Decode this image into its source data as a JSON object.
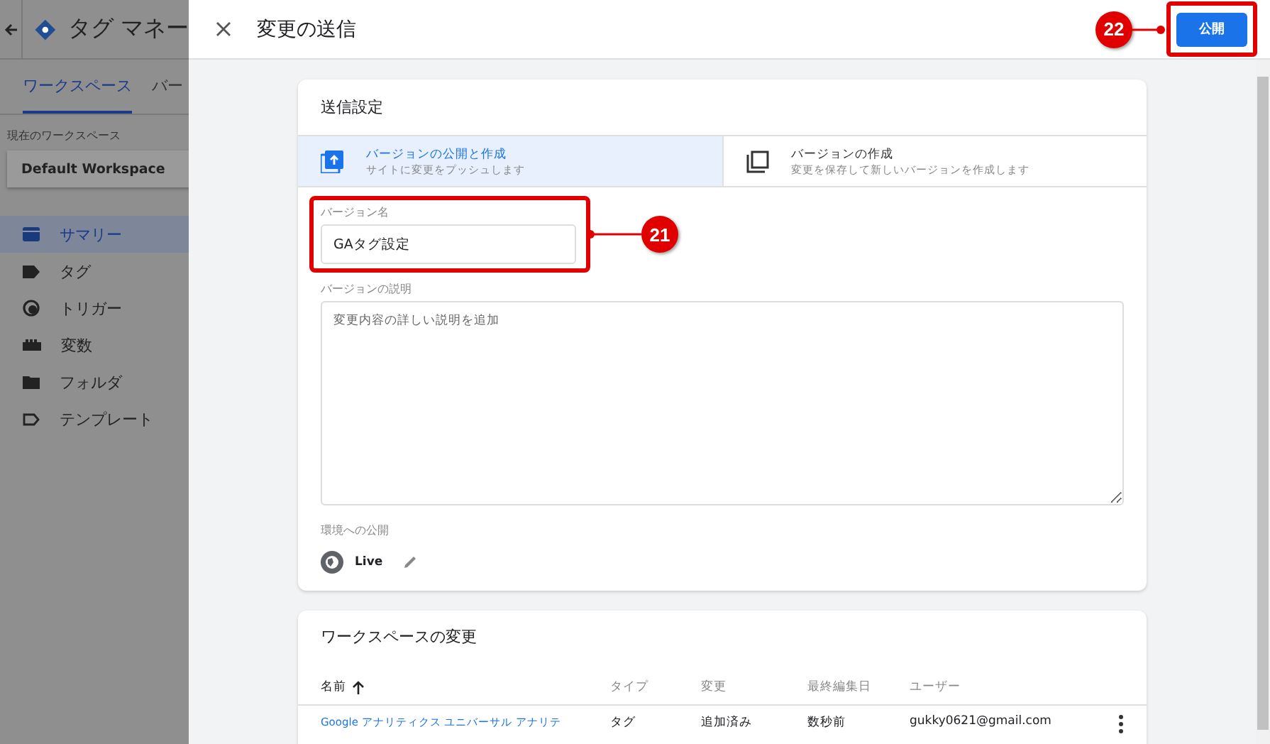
{
  "sidebar": {
    "app_title": "タグ マネー",
    "tabs": [
      {
        "label": "ワークスペース",
        "selected": true
      },
      {
        "label": "バー",
        "selected": false
      }
    ],
    "workspace_label": "現在のワークスペース",
    "workspace": "Default Workspace",
    "nav": [
      {
        "label": "サマリー",
        "kind": "summary",
        "selected": true
      },
      {
        "label": "タグ",
        "kind": "tag",
        "selected": false
      },
      {
        "label": "トリガー",
        "kind": "trigger",
        "selected": false
      },
      {
        "label": "変数",
        "kind": "variable",
        "selected": false
      },
      {
        "label": "フォルダ",
        "kind": "folder",
        "selected": false
      },
      {
        "label": "テンプレート",
        "kind": "template",
        "selected": false
      }
    ]
  },
  "dialog": {
    "title": "変更の送信",
    "publish_button": "公開"
  },
  "settings": {
    "title": "送信設定",
    "options": [
      {
        "title": "バージョンの公開と作成",
        "subtitle": "サイトに変更をプッシュします",
        "kind": "publish",
        "selected": true
      },
      {
        "title": "バージョンの作成",
        "subtitle": "変更を保存して新しいバージョンを作成します",
        "kind": "create",
        "selected": false
      }
    ],
    "version_name": {
      "label": "バージョン名",
      "value": "GAタグ設定"
    },
    "description": {
      "label": "バージョンの説明",
      "placeholder": "変更内容の詳しい説明を追加"
    },
    "environment": {
      "label": "環境への公開",
      "name": "Live"
    }
  },
  "changes": {
    "title": "ワークスペースの変更",
    "columns": [
      {
        "label": "名前",
        "sorted": true
      },
      {
        "label": "タイプ",
        "sorted": false
      },
      {
        "label": "変更",
        "sorted": false
      },
      {
        "label": "最終編集日",
        "sorted": false
      },
      {
        "label": "ユーザー",
        "sorted": false
      }
    ],
    "rows": [
      {
        "cells": [
          "Google アナリティクス ユニバーサル アナリテ",
          "タグ",
          "追加済み",
          "数秒前",
          "gukky0621@gmail.com"
        ]
      }
    ]
  },
  "annotations": [
    {
      "number": "21"
    },
    {
      "number": "22"
    }
  ]
}
